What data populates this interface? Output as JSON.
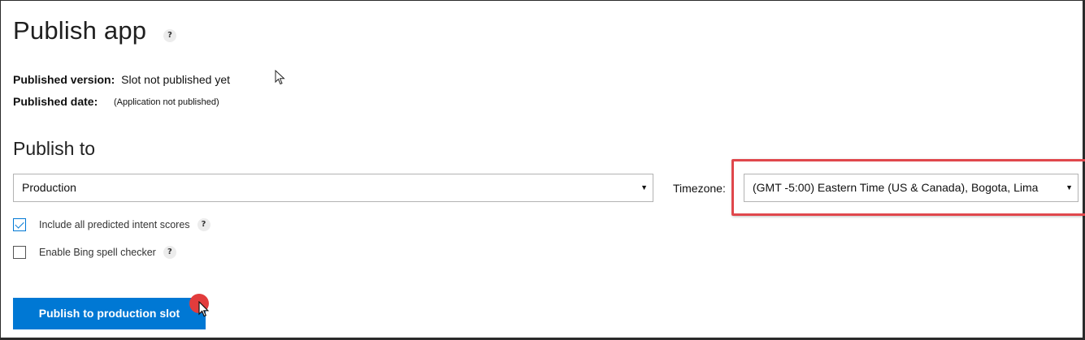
{
  "page": {
    "title": "Publish app",
    "help_glyph": "?"
  },
  "info": {
    "published_version_label": "Published version:",
    "published_version_value": "Slot not published yet",
    "published_date_label": "Published date:",
    "published_date_value": "(Application not published)"
  },
  "publish_to": {
    "heading": "Publish to",
    "environment_selected": "Production",
    "timezone_label": "Timezone:",
    "timezone_selected": "(GMT -5:00) Eastern Time (US & Canada), Bogota, Lima",
    "dropdown_arrow": "▼"
  },
  "options": [
    {
      "label": "Include all predicted intent scores",
      "checked": true
    },
    {
      "label": "Enable Bing spell checker",
      "checked": false
    }
  ],
  "actions": {
    "publish_button": "Publish to production slot"
  },
  "colors": {
    "accent": "#0078d4",
    "highlight": "#e0474c",
    "click_marker": "#e23c3c"
  },
  "icons": {
    "help": "question-circle-icon",
    "dropdown": "caret-down-icon",
    "check": "checkmark-icon",
    "pointer": "mouse-pointer-icon"
  }
}
